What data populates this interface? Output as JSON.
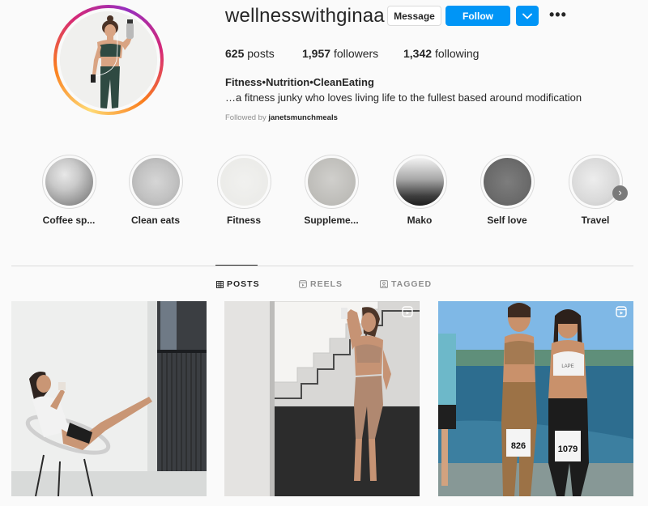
{
  "profile": {
    "username": "wellnesswithginaa",
    "message_label": "Message",
    "follow_label": "Follow",
    "more_label": "•••",
    "posts_count": "625",
    "posts_label": "posts",
    "followers_count": "1,957",
    "followers_label": "followers",
    "following_count": "1,342",
    "following_label": "following",
    "bio_name": "Fitness•Nutrition•CleanEating",
    "bio_text": "…a fitness junky who loves living life to the fullest based around modification",
    "followed_by_label": "Followed by",
    "followed_by_user": "janetsmunchmeals"
  },
  "highlights": [
    {
      "label": "Coffee sp..."
    },
    {
      "label": "Clean eats"
    },
    {
      "label": "Fitness"
    },
    {
      "label": "Suppleme..."
    },
    {
      "label": "Mako"
    },
    {
      "label": "Self love"
    },
    {
      "label": "Travel"
    }
  ],
  "tabs": [
    {
      "label": "POSTS",
      "icon": "grid-icon",
      "active": true
    },
    {
      "label": "REELS",
      "icon": "reels-icon",
      "active": false
    },
    {
      "label": "TAGGED",
      "icon": "tagged-icon",
      "active": false
    }
  ],
  "posts": [
    {
      "alt": "post-1",
      "reel": false
    },
    {
      "alt": "post-2",
      "reel": true
    },
    {
      "alt": "post-3",
      "reel": true
    }
  ],
  "post_bibs": {
    "left": "826",
    "right": "1079"
  },
  "tank_text": "LAPE",
  "colors": {
    "accent": "#0095f6",
    "text": "#262626",
    "muted": "#8e8e8e",
    "border": "#dbdbdb"
  }
}
